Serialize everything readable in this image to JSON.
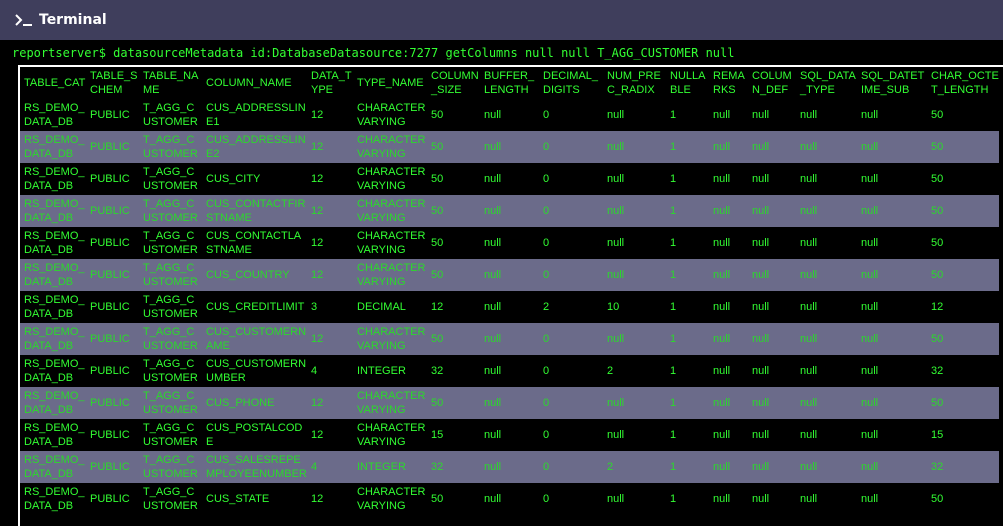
{
  "window": {
    "title": "Terminal",
    "icon": "terminal-prompt-icon"
  },
  "colors": {
    "accent_text": "#33ff33",
    "row_alt": "#6b6b8a",
    "background": "#000000"
  },
  "command": "reportserver$ datasourceMetadata id:DatabaseDatasource:7277 getColumns null null T_AGG_CUSTOMER null",
  "table": {
    "headers": [
      "TABLE_CAT",
      "TABLE_SCHEM",
      "TABLE_NAME",
      "COLUMN_NAME",
      "DATA_TYPE",
      "TYPE_NAME",
      "COLUMN_SIZE",
      "BUFFER_LENGTH",
      "DECIMAL_DIGITS",
      "NUM_PREC_RADIX",
      "NULLABLE",
      "REMARKS",
      "COLUMN_DEF",
      "SQL_DATA_TYPE",
      "SQL_DATETIME_SUB",
      "CHAR_OCTET_LENGTH"
    ],
    "rows": [
      [
        "RS_DEMO_DATA_DB",
        "PUBLIC",
        "T_AGG_CUSTOMER",
        "CUS_ADDRESSLINE1",
        "12",
        "CHARACTER VARYING",
        "50",
        "null",
        "0",
        "null",
        "1",
        "null",
        "null",
        "null",
        "null",
        "50"
      ],
      [
        "RS_DEMO_DATA_DB",
        "PUBLIC",
        "T_AGG_CUSTOMER",
        "CUS_ADDRESSLINE2",
        "12",
        "CHARACTER VARYING",
        "50",
        "null",
        "0",
        "null",
        "1",
        "null",
        "null",
        "null",
        "null",
        "50"
      ],
      [
        "RS_DEMO_DATA_DB",
        "PUBLIC",
        "T_AGG_CUSTOMER",
        "CUS_CITY",
        "12",
        "CHARACTER VARYING",
        "50",
        "null",
        "0",
        "null",
        "1",
        "null",
        "null",
        "null",
        "null",
        "50"
      ],
      [
        "RS_DEMO_DATA_DB",
        "PUBLIC",
        "T_AGG_CUSTOMER",
        "CUS_CONTACTFIRSTNAME",
        "12",
        "CHARACTER VARYING",
        "50",
        "null",
        "0",
        "null",
        "1",
        "null",
        "null",
        "null",
        "null",
        "50"
      ],
      [
        "RS_DEMO_DATA_DB",
        "PUBLIC",
        "T_AGG_CUSTOMER",
        "CUS_CONTACTLASTNAME",
        "12",
        "CHARACTER VARYING",
        "50",
        "null",
        "0",
        "null",
        "1",
        "null",
        "null",
        "null",
        "null",
        "50"
      ],
      [
        "RS_DEMO_DATA_DB",
        "PUBLIC",
        "T_AGG_CUSTOMER",
        "CUS_COUNTRY",
        "12",
        "CHARACTER VARYING",
        "50",
        "null",
        "0",
        "null",
        "1",
        "null",
        "null",
        "null",
        "null",
        "50"
      ],
      [
        "RS_DEMO_DATA_DB",
        "PUBLIC",
        "T_AGG_CUSTOMER",
        "CUS_CREDITLIMIT",
        "3",
        "DECIMAL",
        "12",
        "null",
        "2",
        "10",
        "1",
        "null",
        "null",
        "null",
        "null",
        "12"
      ],
      [
        "RS_DEMO_DATA_DB",
        "PUBLIC",
        "T_AGG_CUSTOMER",
        "CUS_CUSTOMERNAME",
        "12",
        "CHARACTER VARYING",
        "50",
        "null",
        "0",
        "null",
        "1",
        "null",
        "null",
        "null",
        "null",
        "50"
      ],
      [
        "RS_DEMO_DATA_DB",
        "PUBLIC",
        "T_AGG_CUSTOMER",
        "CUS_CUSTOMERNUMBER",
        "4",
        "INTEGER",
        "32",
        "null",
        "0",
        "2",
        "1",
        "null",
        "null",
        "null",
        "null",
        "32"
      ],
      [
        "RS_DEMO_DATA_DB",
        "PUBLIC",
        "T_AGG_CUSTOMER",
        "CUS_PHONE",
        "12",
        "CHARACTER VARYING",
        "50",
        "null",
        "0",
        "null",
        "1",
        "null",
        "null",
        "null",
        "null",
        "50"
      ],
      [
        "RS_DEMO_DATA_DB",
        "PUBLIC",
        "T_AGG_CUSTOMER",
        "CUS_POSTALCODE",
        "12",
        "CHARACTER VARYING",
        "15",
        "null",
        "0",
        "null",
        "1",
        "null",
        "null",
        "null",
        "null",
        "15"
      ],
      [
        "RS_DEMO_DATA_DB",
        "PUBLIC",
        "T_AGG_CUSTOMER",
        "CUS_SALESREPEMPLOYEENUMBER",
        "4",
        "INTEGER",
        "32",
        "null",
        "0",
        "2",
        "1",
        "null",
        "null",
        "null",
        "null",
        "32"
      ],
      [
        "RS_DEMO_DATA_DB",
        "PUBLIC",
        "T_AGG_CUSTOMER",
        "CUS_STATE",
        "12",
        "CHARACTER VARYING",
        "50",
        "null",
        "0",
        "null",
        "1",
        "null",
        "null",
        "null",
        "null",
        "50"
      ]
    ]
  }
}
